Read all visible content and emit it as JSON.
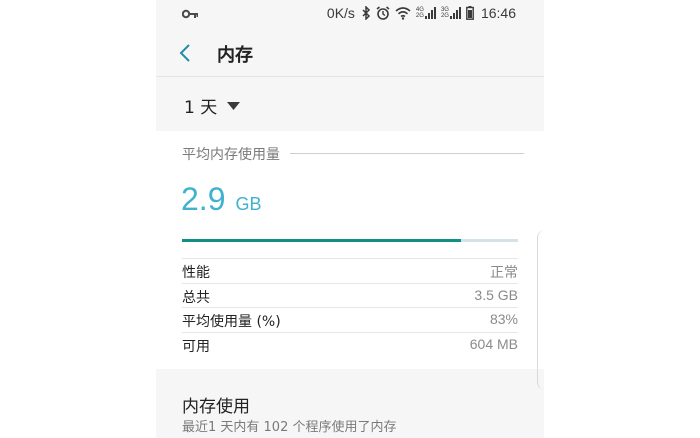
{
  "status_bar": {
    "net_speed": "0K/s",
    "time": "16:46",
    "icons": [
      "key-icon",
      "bluetooth-icon",
      "alarm-icon",
      "wifi-icon",
      "signal-4g-icon",
      "signal-3g-icon",
      "battery-icon"
    ],
    "signal_labels": [
      "4G",
      "2G",
      "3G",
      "2G"
    ]
  },
  "app_bar": {
    "title": "内存",
    "back_icon": "chevron-left-icon"
  },
  "period_selector": {
    "value": "1 天",
    "dropdown_icon": "triangle-down-icon"
  },
  "average_usage": {
    "header": "平均内存使用量",
    "value": "2.9",
    "unit": "GB",
    "fill_fraction": 0.83,
    "fill_color": "#118f86",
    "value_color": "#3fb2d0"
  },
  "stats": [
    {
      "label": "性能",
      "value": "正常"
    },
    {
      "label": "总共",
      "value": "3.5 GB"
    },
    {
      "label": "平均使用量 (%)",
      "value": "83%"
    },
    {
      "label": "可用",
      "value": "604 MB"
    }
  ],
  "memory_usage": {
    "title": "内存使用",
    "subtitle": "最近1 天内有 102 个程序使用了内存"
  }
}
